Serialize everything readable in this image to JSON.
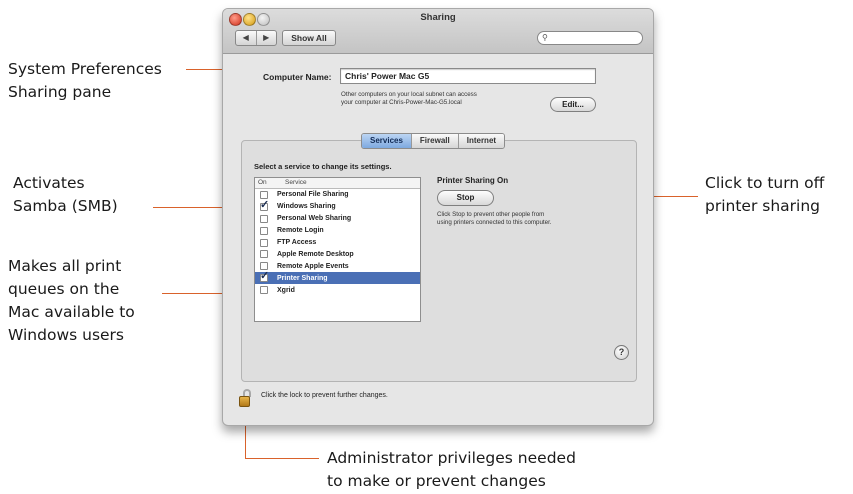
{
  "callouts": {
    "system_prefs": [
      "System Preferences",
      "Sharing pane"
    ],
    "samba": [
      "Activates",
      "Samba (SMB)"
    ],
    "print_queues": [
      "Makes all print",
      "queues on the",
      "Mac available to",
      "Windows users"
    ],
    "turn_off": [
      "Click to turn off",
      "printer sharing"
    ],
    "admin": [
      "Administrator privileges needed",
      "to make or prevent changes"
    ]
  },
  "window": {
    "title": "Sharing",
    "nav_back": "◀",
    "nav_forward": "▶",
    "show_all": "Show All",
    "search_icon": "magnifier-icon",
    "computer_name_label": "Computer Name:",
    "computer_name_value": "Chris' Power Mac G5",
    "subnet_text": [
      "Other computers on your local subnet can access",
      "your computer at Chris-Power-Mac-G5.local"
    ],
    "edit_button": "Edit...",
    "tabs": [
      "Services",
      "Firewall",
      "Internet"
    ],
    "active_tab": "Services",
    "instruction": "Select a service to change its settings.",
    "list_headers": [
      "On",
      "Service"
    ],
    "services": [
      {
        "name": "Personal File Sharing",
        "on": false
      },
      {
        "name": "Windows Sharing",
        "on": true
      },
      {
        "name": "Personal Web Sharing",
        "on": false
      },
      {
        "name": "Remote Login",
        "on": false
      },
      {
        "name": "FTP Access",
        "on": false
      },
      {
        "name": "Apple Remote Desktop",
        "on": false
      },
      {
        "name": "Remote Apple Events",
        "on": false
      },
      {
        "name": "Printer Sharing",
        "on": true,
        "selected": true
      },
      {
        "name": "Xgrid",
        "on": false
      }
    ],
    "status_title": "Printer Sharing On",
    "stop_button": "Stop",
    "status_desc": [
      "Click Stop to prevent other people from",
      "using printers connected to this computer."
    ],
    "help_button": "?",
    "lock_text": "Click the lock to prevent further changes."
  },
  "colors": {
    "callout_line": "#d9622b",
    "selection": "#4a6fb5",
    "active_tab": "#7ea9e0"
  }
}
